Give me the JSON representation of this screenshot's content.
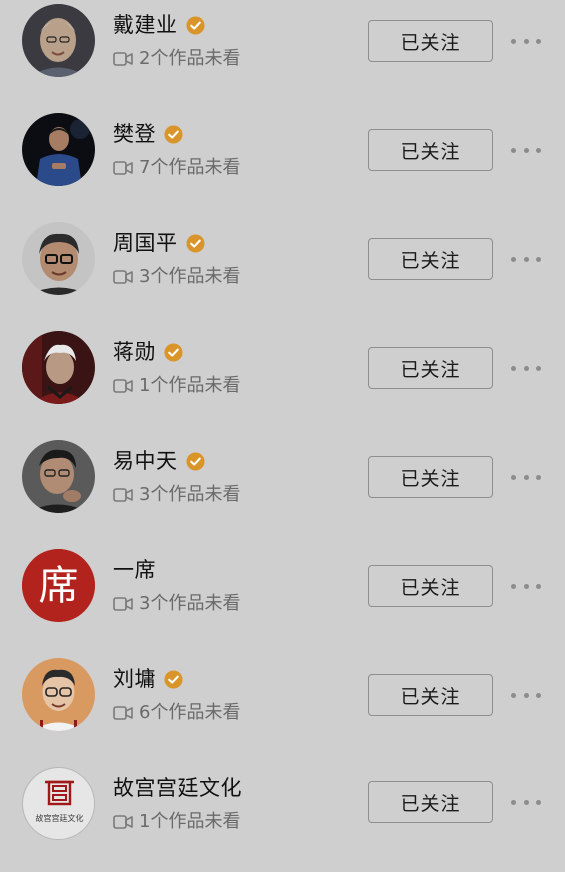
{
  "follow_list": {
    "items": [
      {
        "name": "戴建业",
        "verified": true,
        "unseen_text": "2个作品未看",
        "button_label": "已关注",
        "avatar": "portrait-photo"
      },
      {
        "name": "樊登",
        "verified": true,
        "unseen_text": "7个作品未看",
        "button_label": "已关注",
        "avatar": "portrait-photo"
      },
      {
        "name": "周国平",
        "verified": true,
        "unseen_text": "3个作品未看",
        "button_label": "已关注",
        "avatar": "portrait-photo"
      },
      {
        "name": "蒋勋",
        "verified": true,
        "unseen_text": "1个作品未看",
        "button_label": "已关注",
        "avatar": "portrait-photo"
      },
      {
        "name": "易中天",
        "verified": true,
        "unseen_text": "3个作品未看",
        "button_label": "已关注",
        "avatar": "portrait-photo"
      },
      {
        "name": "一席",
        "verified": false,
        "unseen_text": "3个作品未看",
        "button_label": "已关注",
        "avatar": "logo",
        "logo_text": "席"
      },
      {
        "name": "刘墉",
        "verified": true,
        "unseen_text": "6个作品未看",
        "button_label": "已关注",
        "avatar": "portrait-photo"
      },
      {
        "name": "故宫宫廷文化",
        "verified": false,
        "unseen_text": "1个作品未看",
        "button_label": "已关注",
        "avatar": "logo",
        "logo_text": "故宫宫廷文化"
      }
    ]
  },
  "icons": {
    "verified": "verified-badge-icon",
    "video": "video-camera-icon",
    "more": "more-horizontal-icon"
  },
  "colors": {
    "background": "#cfcfcf",
    "verified_badge": "#d9952a",
    "yixi_red": "#b3231e",
    "palace_red": "#a01818"
  }
}
